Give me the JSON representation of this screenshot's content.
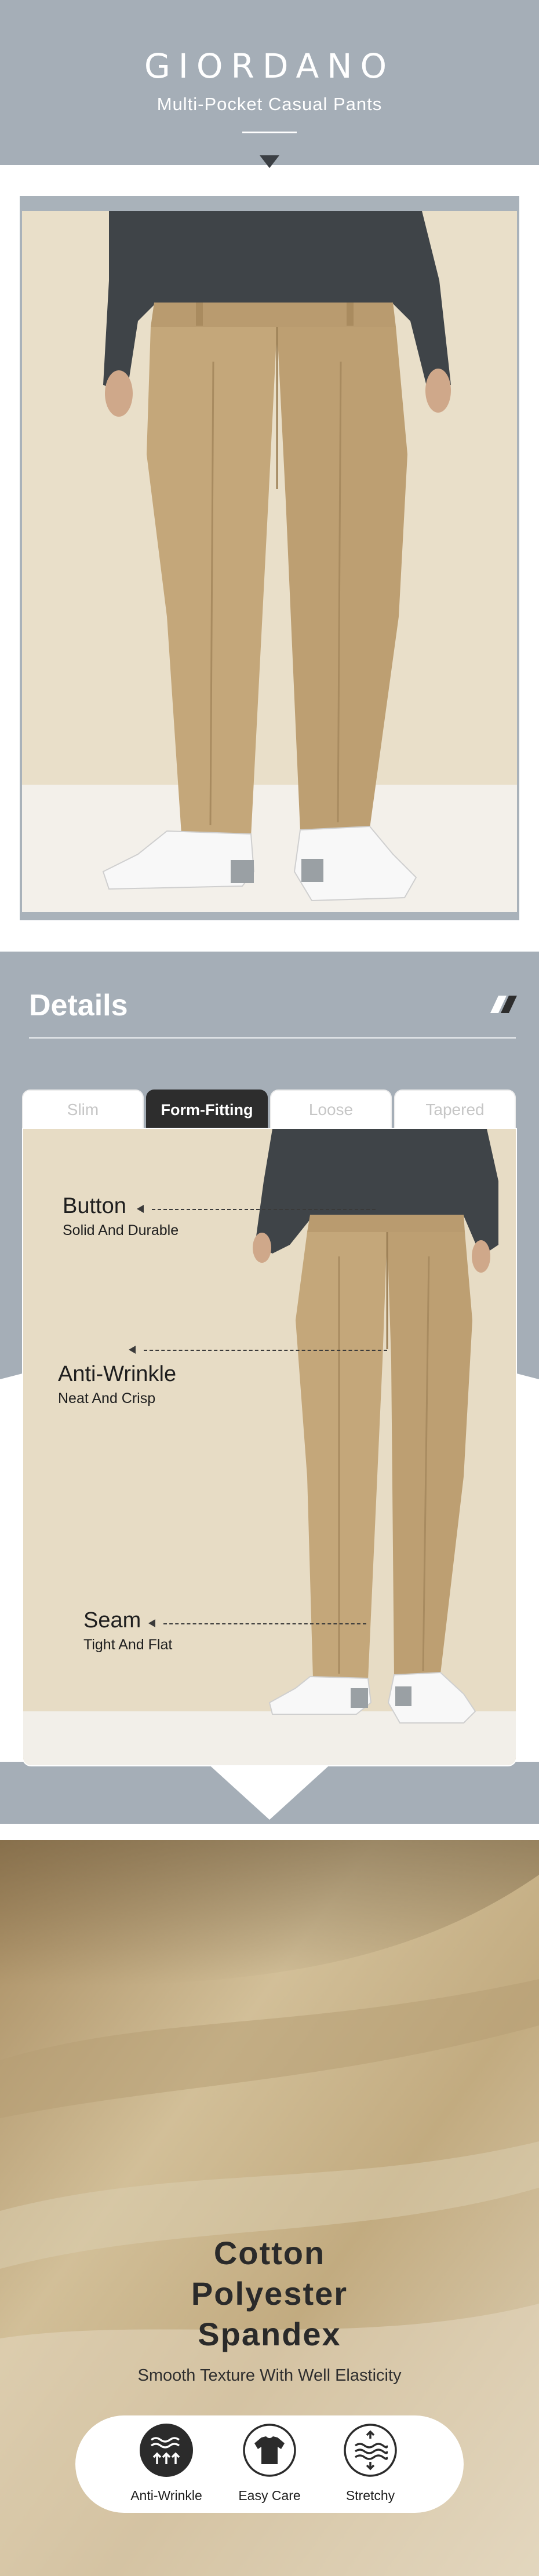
{
  "header": {
    "brand": "GIORDANO",
    "subtitle": "Multi-Pocket Casual Pants"
  },
  "details": {
    "title": "Details",
    "tabs": [
      {
        "label": "Slim",
        "active": false
      },
      {
        "label": "Form-Fitting",
        "active": true
      },
      {
        "label": "Loose",
        "active": false
      },
      {
        "label": "Tapered",
        "active": false
      }
    ],
    "callouts": [
      {
        "title": "Button",
        "sub": "Solid And Durable"
      },
      {
        "title": "Anti-Wrinkle",
        "sub": "Neat And Crisp"
      },
      {
        "title": "Seam",
        "sub": "Tight And Flat"
      }
    ]
  },
  "fabric": {
    "title_lines": [
      "Cotton",
      "Polyester",
      "Spandex"
    ],
    "subtitle": "Smooth Texture With Well Elasticity",
    "features": [
      {
        "label": "Anti-Wrinkle",
        "icon": "anti-wrinkle-icon"
      },
      {
        "label": "Easy Care",
        "icon": "t-shirt-icon"
      },
      {
        "label": "Stretchy",
        "icon": "stretch-icon"
      }
    ]
  },
  "colors": {
    "header_bg": "#a5aeb7",
    "khaki": "#c4a77a",
    "sweater": "#3f4448",
    "tab_active": "#2d2d2d"
  }
}
